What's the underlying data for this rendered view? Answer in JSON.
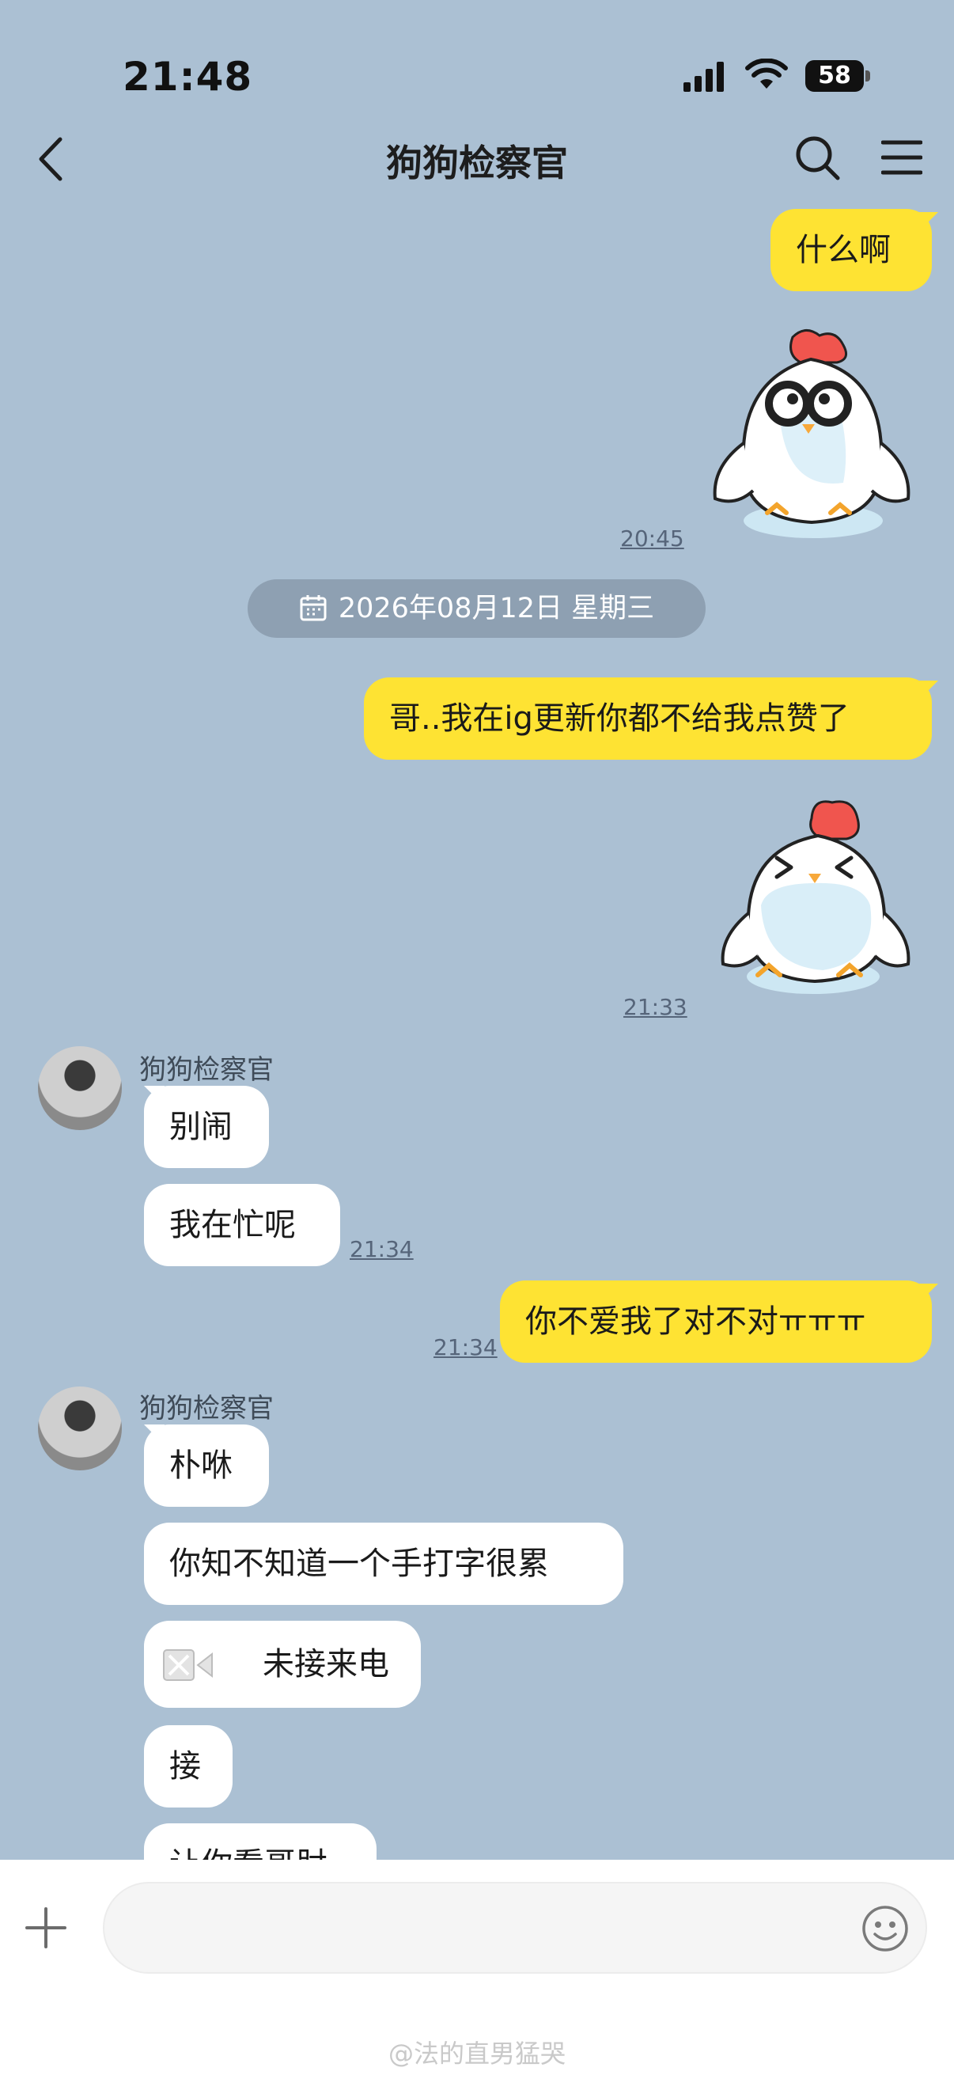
{
  "status_bar": {
    "time": "21:48",
    "battery": "58"
  },
  "header": {
    "title": "狗狗检察官"
  },
  "messages": {
    "m1": {
      "text": "什么啊"
    },
    "t1": {
      "time": "20:45"
    },
    "date_separator": {
      "text": "2026年08月12日 星期三"
    },
    "m2": {
      "text": "哥..我在ig更新你都不给我点赞了"
    },
    "t2": {
      "time": "21:33"
    },
    "sender1": {
      "name": "狗狗检察官"
    },
    "m3": {
      "text": "别闹"
    },
    "m4": {
      "text": "我在忙呢"
    },
    "t3": {
      "time": "21:34"
    },
    "m5": {
      "text": "你不爱我了对不对ㅠㅠㅠ"
    },
    "t4": {
      "time": "21:34"
    },
    "sender2": {
      "name": "狗狗检察官"
    },
    "m6": {
      "text": "朴咻"
    },
    "m7": {
      "text": "你知不知道一个手打字很累"
    },
    "m8": {
      "text": "未接来电"
    },
    "m9": {
      "text": "接"
    },
    "m10": {
      "text": "让你看哥肘"
    }
  },
  "watermark": {
    "text": "@法的直男猛哭"
  },
  "colors": {
    "background": "#abc0d3",
    "my_bubble": "#fee333",
    "their_bubble": "#ffffff"
  },
  "icons": [
    "back-chevron-icon",
    "search-icon",
    "menu-icon",
    "calendar-icon",
    "video-call-icon",
    "plus-icon",
    "emoji-icon",
    "cellular-signal-icon",
    "wifi-icon",
    "battery-icon"
  ]
}
